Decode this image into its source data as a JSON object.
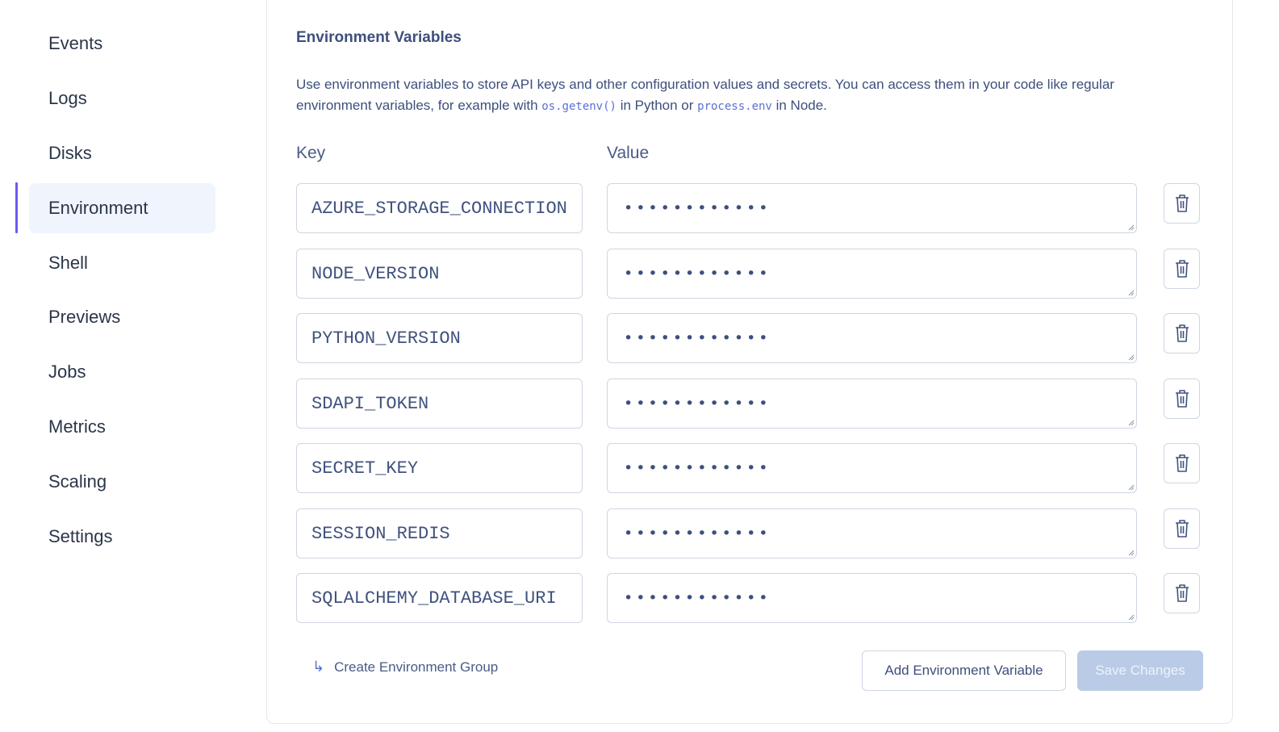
{
  "sidebar": {
    "items": [
      {
        "label": "Events"
      },
      {
        "label": "Logs"
      },
      {
        "label": "Disks"
      },
      {
        "label": "Environment",
        "active": true
      },
      {
        "label": "Shell"
      },
      {
        "label": "Previews"
      },
      {
        "label": "Jobs"
      },
      {
        "label": "Metrics"
      },
      {
        "label": "Scaling"
      },
      {
        "label": "Settings"
      }
    ]
  },
  "env": {
    "title": "Environment Variables",
    "description": {
      "part1": "Use environment variables to store API keys and other configuration values and secrets. You can access them in your code like regular environment variables, for example with ",
      "code1": "os.getenv()",
      "part2": " in Python or ",
      "code2": "process.env",
      "part3": " in Node."
    },
    "key_label": "Key",
    "value_label": "Value",
    "rows": [
      {
        "key": "AZURE_STORAGE_CONNECTION_STRING",
        "value_mask": "••••••••••••"
      },
      {
        "key": "NODE_VERSION",
        "value_mask": "••••••••••••"
      },
      {
        "key": "PYTHON_VERSION",
        "value_mask": "••••••••••••"
      },
      {
        "key": "SDAPI_TOKEN",
        "value_mask": "••••••••••••"
      },
      {
        "key": "SECRET_KEY",
        "value_mask": "••••••••••••"
      },
      {
        "key": "SESSION_REDIS",
        "value_mask": "••••••••••••"
      },
      {
        "key": "SQLALCHEMY_DATABASE_URI",
        "value_mask": "••••••••••••"
      }
    ],
    "delete_icon": "trash-icon",
    "create_group_label": "Create Environment Group",
    "create_group_icon": "arrow-return-icon",
    "add_button": "Add Environment Variable",
    "save_button": "Save Changes"
  },
  "colors": {
    "accent": "#6a5cf0",
    "active_bg": "#f0f4fd",
    "save_disabled_bg": "#b9cbe6",
    "link": "#5a6fd8"
  }
}
